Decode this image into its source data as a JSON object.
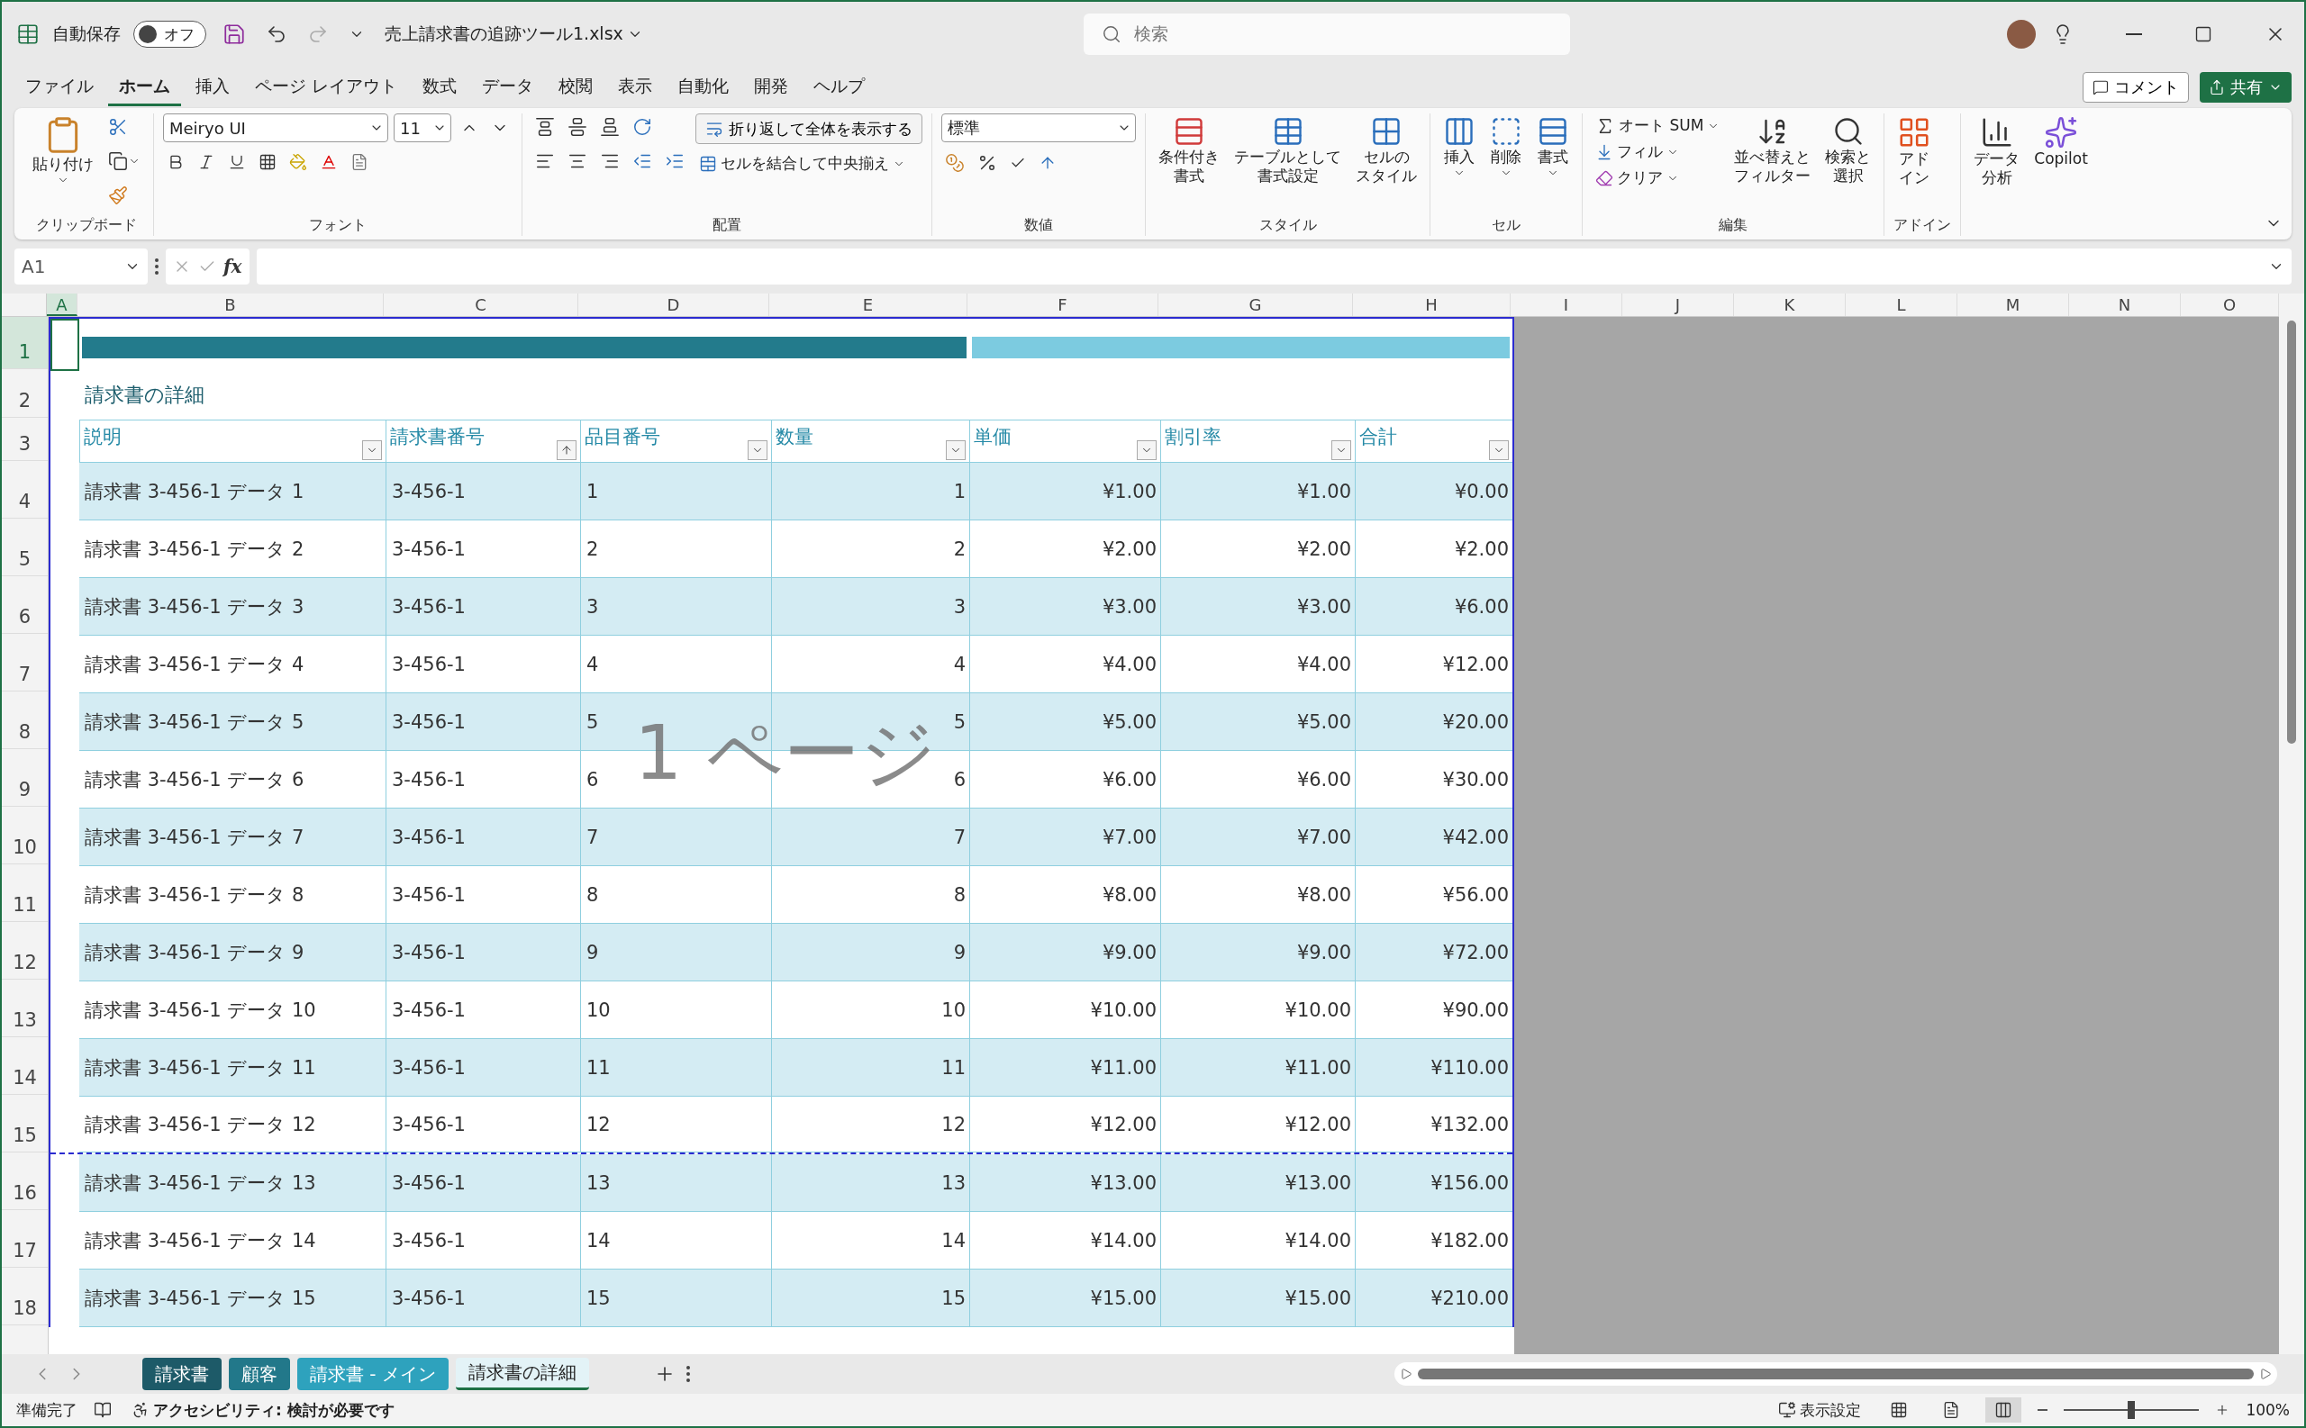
{
  "title_bar": {
    "autosave_label": "自動保存",
    "autosave_toggle": {
      "label": "オフ",
      "on": false
    },
    "filename": "売上請求書の追跡ツール1.xlsx",
    "search_placeholder": "検索"
  },
  "menu_tabs": [
    {
      "label": "ファイル",
      "selected": false
    },
    {
      "label": "ホーム",
      "selected": true
    },
    {
      "label": "挿入",
      "selected": false
    },
    {
      "label": "ページ レイアウト",
      "selected": false
    },
    {
      "label": "数式",
      "selected": false
    },
    {
      "label": "データ",
      "selected": false
    },
    {
      "label": "校閲",
      "selected": false
    },
    {
      "label": "表示",
      "selected": false
    },
    {
      "label": "自動化",
      "selected": false
    },
    {
      "label": "開発",
      "selected": false
    },
    {
      "label": "ヘルプ",
      "selected": false
    }
  ],
  "comment_button": "コメント",
  "share_button": "共有",
  "ribbon": {
    "clipboard": {
      "paste": "貼り付け",
      "group": "クリップボード"
    },
    "font": {
      "name": "Meiryo UI",
      "size": "11",
      "group": "フォント"
    },
    "alignment": {
      "wrap": "折り返して全体を表示する",
      "merge": "セルを結合して中央揃え",
      "group": "配置"
    },
    "number": {
      "format": "標準",
      "group": "数値"
    },
    "styles": {
      "buttons": [
        {
          "lines": [
            "条件付き",
            "書式"
          ]
        },
        {
          "lines": [
            "テーブルとして",
            "書式設定"
          ]
        },
        {
          "lines": [
            "セルの",
            "スタイル"
          ]
        }
      ],
      "group": "スタイル"
    },
    "cells": {
      "buttons": [
        "挿入",
        "削除",
        "書式"
      ],
      "group": "セル"
    },
    "editing": {
      "autosum": "オート SUM",
      "fill": "フィル",
      "clear": "クリア",
      "sort": {
        "lines": [
          "並べ替えと",
          "フィルター"
        ]
      },
      "find": {
        "lines": [
          "検索と",
          "選択"
        ]
      },
      "group": "編集"
    },
    "addins": {
      "lines": [
        "アド",
        "イン"
      ],
      "group": "アドイン"
    },
    "analyze": {
      "lines": [
        "データ",
        "分析"
      ]
    },
    "copilot": "Copilot"
  },
  "formula_bar": {
    "name_box": "A1",
    "fx": "fx"
  },
  "row_numbers": [
    "1",
    "2",
    "3",
    "4",
    "5",
    "6",
    "7",
    "8",
    "9",
    "10",
    "11",
    "12",
    "13",
    "14",
    "15",
    "16",
    "17",
    "18"
  ],
  "columns": [
    "A",
    "B",
    "C",
    "D",
    "E",
    "F",
    "G",
    "H",
    "I",
    "J",
    "K",
    "L",
    "M",
    "N",
    "O"
  ],
  "sheet": {
    "title": "請求書の詳細",
    "page_label": "1 ページ",
    "headers": [
      {
        "label": "説明",
        "sorted": false
      },
      {
        "label": "請求書番号",
        "sorted": true
      },
      {
        "label": "品目番号",
        "sorted": false
      },
      {
        "label": "数量",
        "sorted": false
      },
      {
        "label": "単価",
        "sorted": false
      },
      {
        "label": "割引率",
        "sorted": false
      },
      {
        "label": "合計",
        "sorted": false
      }
    ],
    "rows": [
      [
        "請求書 3-456-1 データ 1",
        "3-456-1",
        "1",
        "1",
        "¥1.00",
        "¥1.00",
        "¥0.00"
      ],
      [
        "請求書 3-456-1 データ 2",
        "3-456-1",
        "2",
        "2",
        "¥2.00",
        "¥2.00",
        "¥2.00"
      ],
      [
        "請求書 3-456-1 データ 3",
        "3-456-1",
        "3",
        "3",
        "¥3.00",
        "¥3.00",
        "¥6.00"
      ],
      [
        "請求書 3-456-1 データ 4",
        "3-456-1",
        "4",
        "4",
        "¥4.00",
        "¥4.00",
        "¥12.00"
      ],
      [
        "請求書 3-456-1 データ 5",
        "3-456-1",
        "5",
        "5",
        "¥5.00",
        "¥5.00",
        "¥20.00"
      ],
      [
        "請求書 3-456-1 データ 6",
        "3-456-1",
        "6",
        "6",
        "¥6.00",
        "¥6.00",
        "¥30.00"
      ],
      [
        "請求書 3-456-1 データ 7",
        "3-456-1",
        "7",
        "7",
        "¥7.00",
        "¥7.00",
        "¥42.00"
      ],
      [
        "請求書 3-456-1 データ 8",
        "3-456-1",
        "8",
        "8",
        "¥8.00",
        "¥8.00",
        "¥56.00"
      ],
      [
        "請求書 3-456-1 データ 9",
        "3-456-1",
        "9",
        "9",
        "¥9.00",
        "¥9.00",
        "¥72.00"
      ],
      [
        "請求書 3-456-1 データ 10",
        "3-456-1",
        "10",
        "10",
        "¥10.00",
        "¥10.00",
        "¥90.00"
      ],
      [
        "請求書 3-456-1 データ 11",
        "3-456-1",
        "11",
        "11",
        "¥11.00",
        "¥11.00",
        "¥110.00"
      ],
      [
        "請求書 3-456-1 データ 12",
        "3-456-1",
        "12",
        "12",
        "¥12.00",
        "¥12.00",
        "¥132.00"
      ],
      [
        "請求書 3-456-1 データ 13",
        "3-456-1",
        "13",
        "13",
        "¥13.00",
        "¥13.00",
        "¥156.00"
      ],
      [
        "請求書 3-456-1 データ 14",
        "3-456-1",
        "14",
        "14",
        "¥14.00",
        "¥14.00",
        "¥182.00"
      ],
      [
        "請求書 3-456-1 データ 15",
        "3-456-1",
        "15",
        "15",
        "¥15.00",
        "¥15.00",
        "¥210.00"
      ]
    ]
  },
  "sheet_tabs": [
    {
      "label": "請求書",
      "selected": false,
      "color": "#1d5a68"
    },
    {
      "label": "顧客",
      "selected": false,
      "color": "#22788a"
    },
    {
      "label": "請求書 - メイン",
      "selected": false,
      "color": "#2ea2bd"
    },
    {
      "label": "請求書の詳細",
      "selected": true,
      "color": "#e3f3f7"
    }
  ],
  "status_bar": {
    "ready": "準備完了",
    "accessibility": "アクセシビリティ: 検討が必要です",
    "display_settings": "表示設定",
    "zoom": {
      "level": 0.5,
      "reading": "100%"
    }
  }
}
